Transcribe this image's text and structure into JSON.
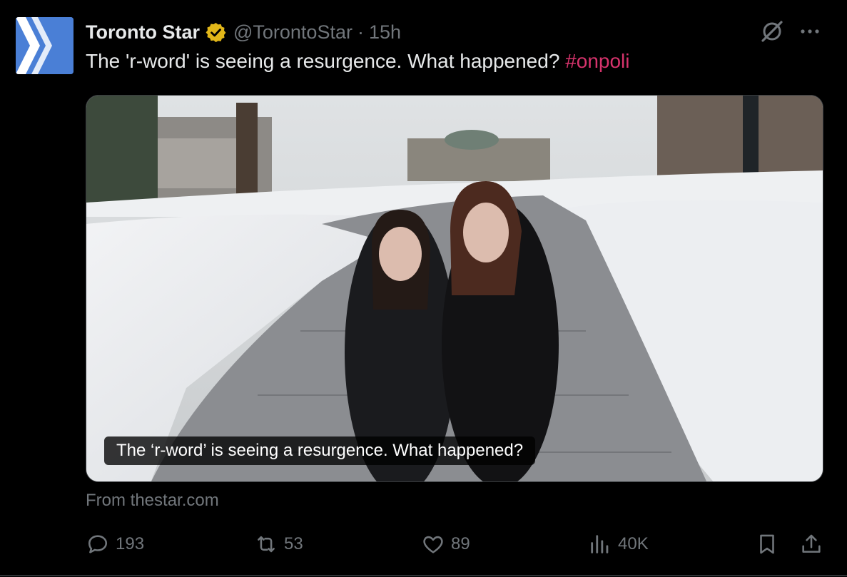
{
  "tweet": {
    "author_name": "Toronto Star",
    "handle": "@TorontoStar",
    "separator": "·",
    "time": "15h",
    "text": "The 'r-word' is seeing a resurgence. What happened?",
    "hashtag": "#onpoli"
  },
  "card": {
    "caption": "The ‘r-word’ is seeing a resurgence. What happened?",
    "source": "From thestar.com"
  },
  "actions": {
    "replies": "193",
    "reposts": "53",
    "likes": "89",
    "views": "40K"
  },
  "icons": {
    "avatar": "toronto-star-logo",
    "verified": "gold-verified-badge-icon",
    "grok": "grok-icon",
    "more": "more-icon",
    "reply": "reply-icon",
    "repost": "repost-icon",
    "like": "heart-icon",
    "views": "views-icon",
    "bookmark": "bookmark-icon",
    "share": "share-icon"
  },
  "colors": {
    "background": "#000000",
    "text": "#e7e9ea",
    "muted": "#71767b",
    "hashtag": "#d6336c",
    "verified": "#e2b719",
    "avatar": "#4a7fd6"
  }
}
